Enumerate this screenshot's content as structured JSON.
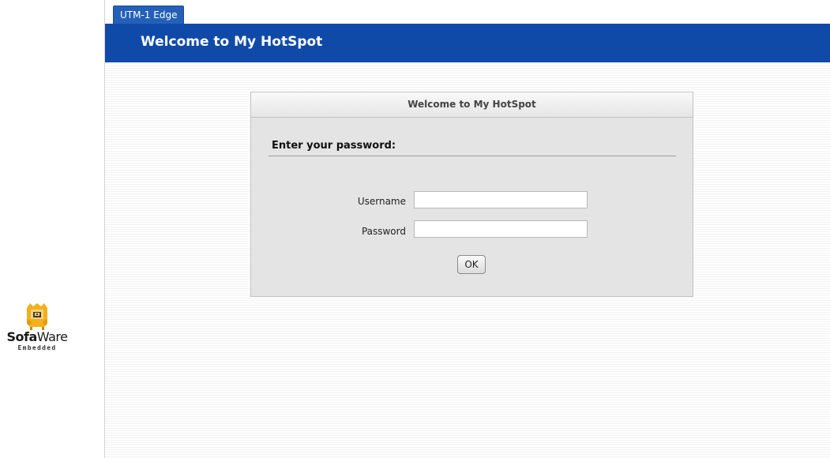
{
  "tab": {
    "label": "UTM-1 Edge"
  },
  "header": {
    "title": "Welcome to My HotSpot"
  },
  "panel": {
    "title": "Welcome to My HotSpot",
    "section_title": "Enter your password:",
    "username_label": "Username",
    "username_value": "",
    "password_label": "Password",
    "password_value": "",
    "ok_label": "OK"
  },
  "logo": {
    "brand_bold": "Sofa",
    "brand_regular": "Ware",
    "tagline": "Embedded",
    "icon": "sofa-icon",
    "colors": {
      "yellow": "#f2b01c",
      "dark": "#3a3a3a"
    }
  },
  "colors": {
    "header_blue": "#0f4aa8",
    "tab_blue": "#2560b8",
    "panel_gray": "#e4e4e4"
  }
}
